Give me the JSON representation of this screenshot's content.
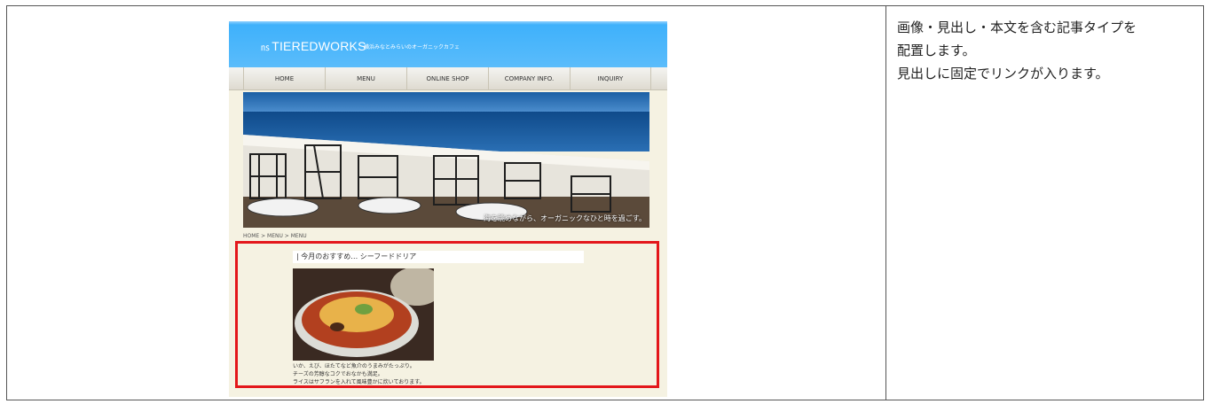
{
  "site": {
    "logo_mark": "㎱",
    "logo_text": "TIEREDWORKS",
    "tagline": "横浜みなとみらいのオーガニックカフェ",
    "nav": [
      "HOME",
      "MENU",
      "ONLINE SHOP",
      "COMPANY INFO.",
      "INQUIRY"
    ],
    "hero_caption": "海を眺めながら、オーガニックなひと時を過ごす。",
    "breadcrumb": "HOME > MENU > MENU",
    "section": {
      "title": "| 今月のおすすめ… シーフードドリア",
      "body": [
        "いか、えび、ほたてなど魚介のうまみがたっぷり。",
        "チーズの芳醇なコクでおなかも満足。",
        "ライスはサフランを入れて風味豊かに炊いております。"
      ]
    }
  },
  "description": [
    "画像・見出し・本文を含む記事タイプを",
    "配置します。",
    "見出しに固定でリンクが入ります。"
  ],
  "colors": {
    "highlight": "#e3171b",
    "header_blue": "#4db7fb",
    "page_bg": "#f5f2e2"
  }
}
